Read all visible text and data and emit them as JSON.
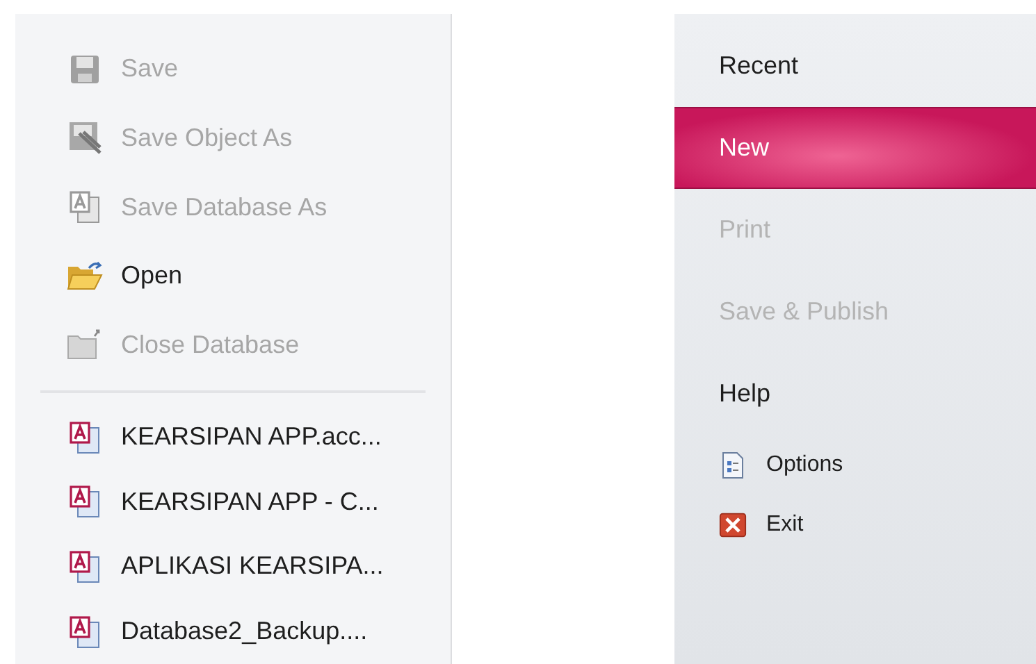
{
  "left_menu": {
    "commands": [
      {
        "label": "Save",
        "kind": "floppy",
        "disabled": true
      },
      {
        "label": "Save Object As",
        "kind": "save_object",
        "disabled": true
      },
      {
        "label": "Save Database As",
        "kind": "database",
        "disabled": true
      },
      {
        "label": "Open",
        "kind": "open_folder",
        "disabled": false
      },
      {
        "label": "Close Database",
        "kind": "close_folder",
        "disabled": true
      }
    ],
    "recent_files": [
      {
        "label": "KEARSIPAN APP.acc..."
      },
      {
        "label": "KEARSIPAN APP - C..."
      },
      {
        "label": "APLIKASI KEARSIPA..."
      },
      {
        "label": "Database2_Backup...."
      }
    ]
  },
  "right_menu": {
    "items": [
      {
        "kind": "tab",
        "label": "Recent",
        "selected": false,
        "disabled": false
      },
      {
        "kind": "tab",
        "label": "New",
        "selected": true,
        "disabled": false
      },
      {
        "kind": "tab",
        "label": "Print",
        "selected": false,
        "disabled": true
      },
      {
        "kind": "tab",
        "label": "Save & Publish",
        "selected": false,
        "disabled": true
      },
      {
        "kind": "tab",
        "label": "Help",
        "selected": false,
        "disabled": false
      },
      {
        "kind": "options",
        "label": "Options"
      },
      {
        "kind": "exit",
        "label": "Exit"
      }
    ]
  }
}
